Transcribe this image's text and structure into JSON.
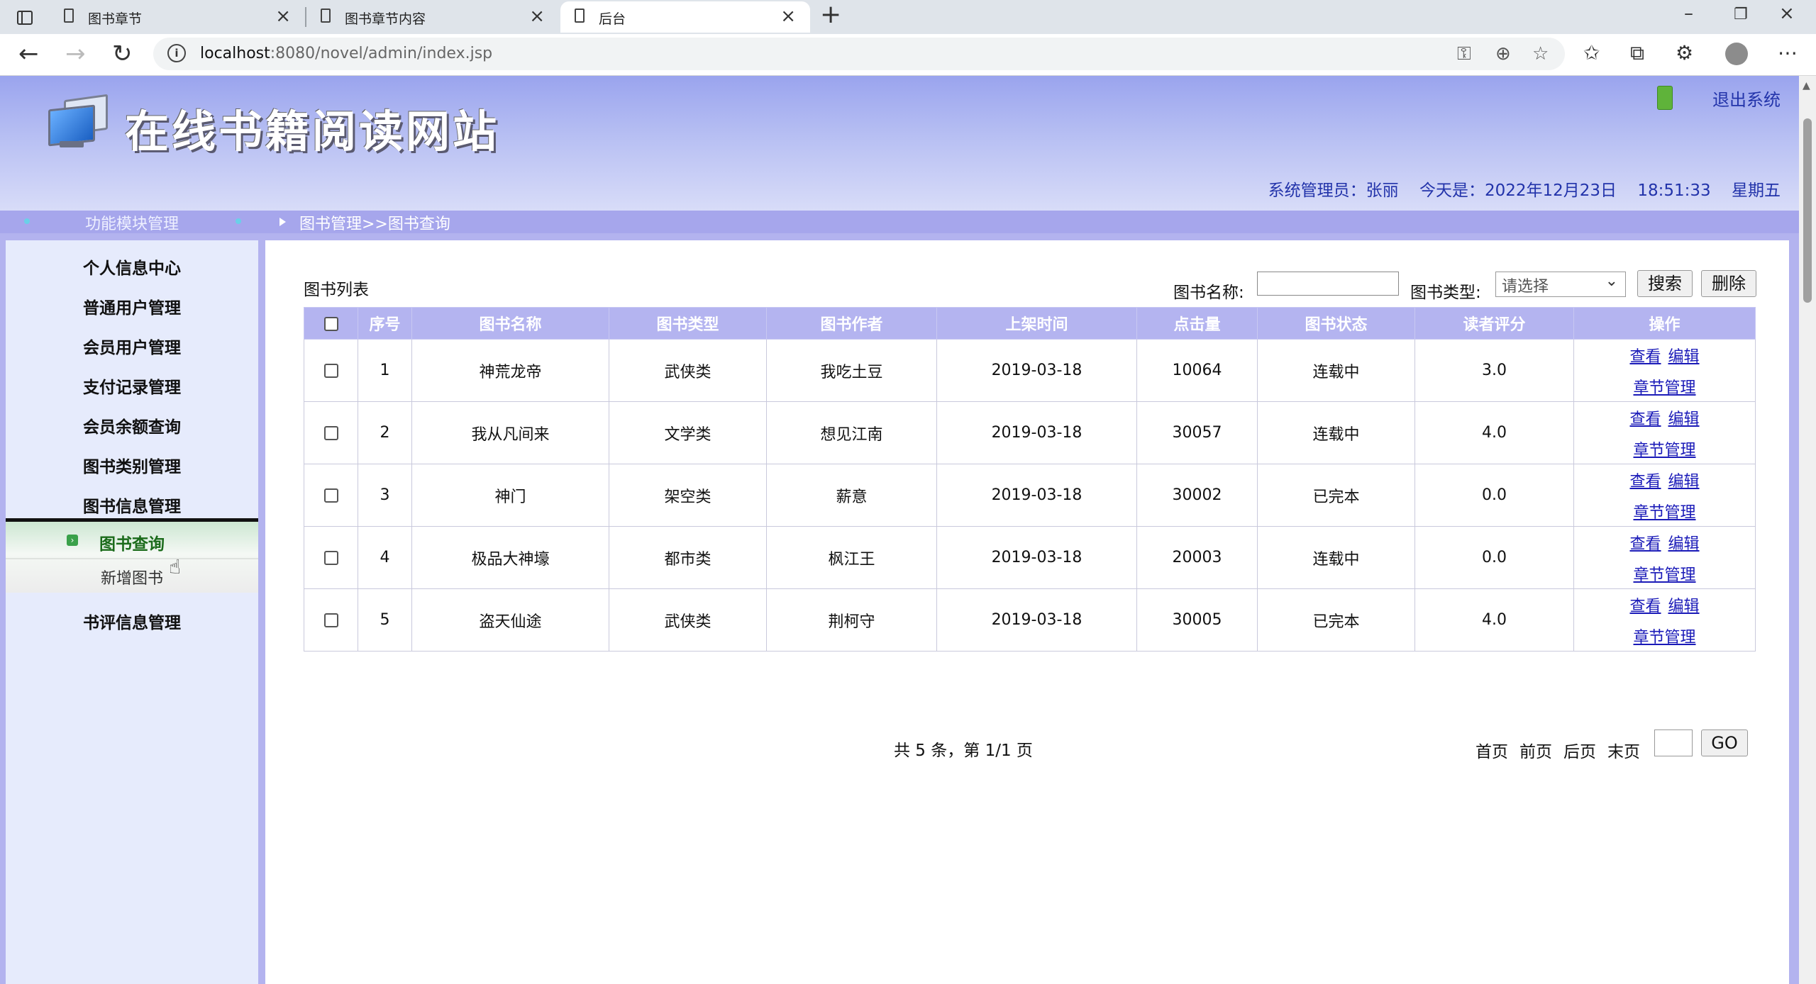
{
  "browser": {
    "tabs": [
      {
        "title": "图书章节",
        "active": false
      },
      {
        "title": "图书章节内容",
        "active": false
      },
      {
        "title": "后台",
        "active": true
      }
    ],
    "url_host": "localhost",
    "url_rest": ":8080/novel/admin/index.jsp"
  },
  "header": {
    "site_title": "在线书籍阅读网站",
    "logout_label": "退出系统",
    "admin_label": "系统管理员：张丽",
    "today_label": "今天是：2022年12月23日",
    "time": "18:51:33",
    "weekday": "星期五"
  },
  "nav_bar": {
    "module_title": "功能模块管理",
    "breadcrumb": "图书管理>>图书查询"
  },
  "sidebar": {
    "items": [
      {
        "label": "个人信息中心"
      },
      {
        "label": "普通用户管理"
      },
      {
        "label": "会员用户管理"
      },
      {
        "label": "支付记录管理"
      },
      {
        "label": "会员余额查询"
      },
      {
        "label": "图书类别管理"
      },
      {
        "label": "图书信息管理"
      },
      {
        "label": "书评信息管理"
      }
    ],
    "sub_current": "图书查询",
    "sub_new": "新增图书"
  },
  "search": {
    "list_title": "图书列表",
    "name_label": "图书名称:",
    "name_value": "",
    "type_label": "图书类型:",
    "type_selected": "请选择",
    "search_button": "搜索",
    "delete_button": "删除"
  },
  "table": {
    "columns": [
      "序号",
      "图书名称",
      "图书类型",
      "图书作者",
      "上架时间",
      "点击量",
      "图书状态",
      "读者评分",
      "操作"
    ],
    "rows": [
      {
        "no": "1",
        "name": "神荒龙帝",
        "type": "武侠类",
        "author": "我吃土豆",
        "date": "2019-03-18",
        "clicks": "10064",
        "status": "连载中",
        "score": "3.0"
      },
      {
        "no": "2",
        "name": "我从凡间来",
        "type": "文学类",
        "author": "想见江南",
        "date": "2019-03-18",
        "clicks": "30057",
        "status": "连载中",
        "score": "4.0"
      },
      {
        "no": "3",
        "name": "神门",
        "type": "架空类",
        "author": "薪意",
        "date": "2019-03-18",
        "clicks": "30002",
        "status": "已完本",
        "score": "0.0"
      },
      {
        "no": "4",
        "name": "极品大神壕",
        "type": "都市类",
        "author": "枫江王",
        "date": "2019-03-18",
        "clicks": "20003",
        "status": "连载中",
        "score": "0.0"
      },
      {
        "no": "5",
        "name": "盗天仙途",
        "type": "武侠类",
        "author": "荆柯守",
        "date": "2019-03-18",
        "clicks": "30005",
        "status": "已完本",
        "score": "4.0"
      }
    ],
    "op_view": "查看",
    "op_edit": "编辑",
    "op_chapters": "章节管理"
  },
  "pagination": {
    "summary": "共 5 条，第 1/1 页",
    "first": "首页",
    "prev": "前页",
    "next": "后页",
    "last": "末页",
    "go_label": "GO",
    "page_value": ""
  }
}
